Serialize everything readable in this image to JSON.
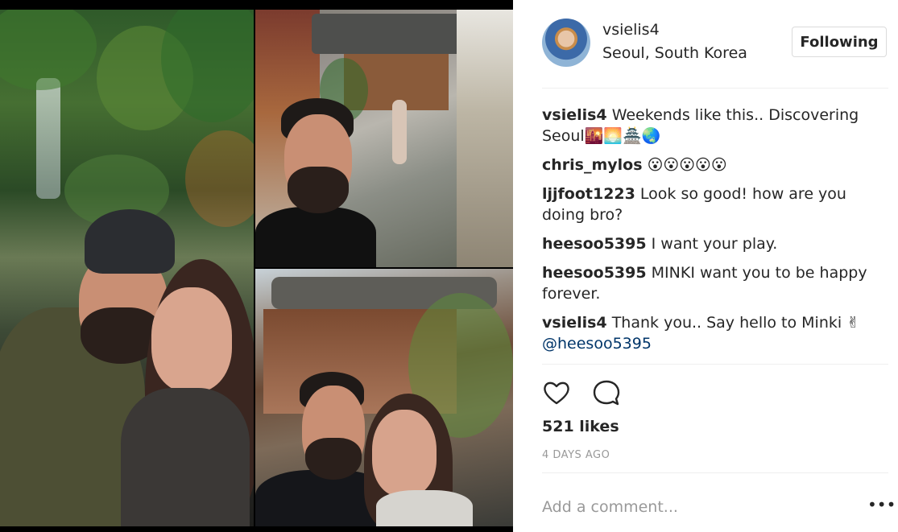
{
  "post": {
    "username": "vsielis4",
    "location": "Seoul, South Korea",
    "follow_label": "Following",
    "likes_text": "521 likes",
    "time_text": "4 DAYS AGO",
    "comment_placeholder": "Add a comment...",
    "more_label": "•••"
  },
  "comments": [
    {
      "user": "vsielis4",
      "text": " Weekends like this.. Discovering Seoul🌇🌅🏯🌏"
    },
    {
      "user": "chris_mylos",
      "text": " 😮😮😮😮😮"
    },
    {
      "user": "ljjfoot1223",
      "text": " Look so good! how are you doing bro?"
    },
    {
      "user": "heesoo5395",
      "text": " I want your play."
    },
    {
      "user": "heesoo5395",
      "text": " MINKI want you to be happy forever."
    },
    {
      "user": "vsielis4",
      "text": " Thank you.. Say hello to Minki ✌",
      "mention": "@heesoo5395"
    }
  ],
  "icons": {
    "like": "heart-icon",
    "comment": "speech-bubble-icon",
    "more": "ellipsis-icon"
  },
  "colors": {
    "text": "#262626",
    "muted": "#999999",
    "mention": "#003569",
    "border": "#dbdbdb"
  }
}
